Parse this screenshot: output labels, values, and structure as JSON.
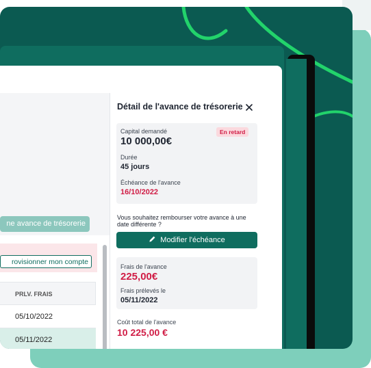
{
  "colors": {
    "brand_green": "#0f6d5f",
    "mint_backdrop": "#7ecfbb",
    "swirl_green": "#22d36b",
    "alert_red": "#d01c45",
    "badge_bg": "#fbd9de"
  },
  "left_panel": {
    "advance_button_label": "ne avance de trésorerie",
    "approv_button_label": "rovisionner mon compte",
    "table": {
      "header": "PRLV. FRAIS",
      "rows": [
        "05/10/2022",
        "05/11/2022"
      ]
    }
  },
  "detail": {
    "title": "Détail de l'avance de trésorerie",
    "close_icon": "close-icon",
    "capital_label": "Capital demandé",
    "capital_value": "10 000,00€",
    "status_badge": "En retard",
    "duration_label": "Durée",
    "duration_value": "45 jours",
    "due_label": "Échéance de l'avance",
    "due_value": "16/10/2022",
    "question": "Vous souhaitez rembourser votre avance à une date différente ?",
    "modify_icon": "pencil-icon",
    "modify_button_label": "Modifier l'échéance",
    "fees_label": "Frais de l'avance",
    "fees_value": "225,00€",
    "fees_charged_label": "Frais prélevés le",
    "fees_charged_value": "05/11/2022",
    "total_label": "Coût total de l'avance",
    "total_value": "10 225,00 €"
  }
}
